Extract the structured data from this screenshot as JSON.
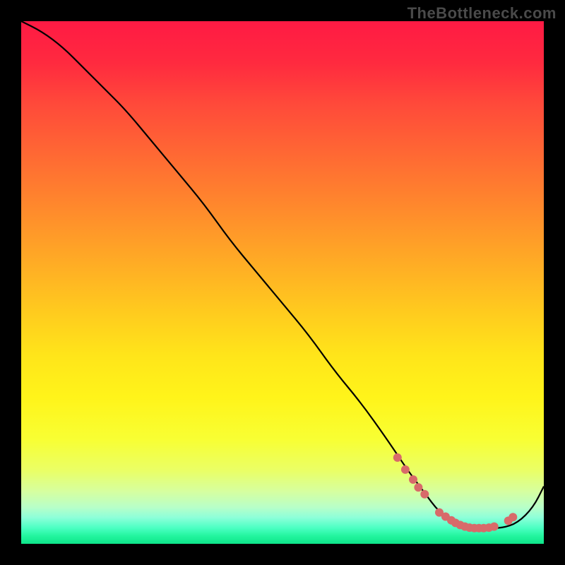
{
  "watermark": "TheBottleneck.com",
  "chart_data": {
    "type": "line",
    "title": "",
    "xlabel": "",
    "ylabel": "",
    "xlim": [
      0,
      100
    ],
    "ylim": [
      0,
      100
    ],
    "grid": false,
    "legend": false,
    "series": [
      {
        "name": "bottleneck-curve",
        "x": [
          0,
          4,
          8,
          12,
          16,
          20,
          25,
          30,
          35,
          40,
          45,
          50,
          55,
          60,
          65,
          70,
          74,
          77,
          80,
          83,
          86,
          89,
          92,
          95,
          98,
          100
        ],
        "y": [
          100,
          98,
          95,
          91,
          87,
          83,
          77,
          71,
          65,
          58,
          52,
          46,
          40,
          33,
          27,
          20,
          14,
          10,
          6,
          4,
          3,
          3,
          3,
          4,
          7,
          11
        ]
      }
    ],
    "markers": {
      "name": "highlighted-points",
      "color": "#d86a6a",
      "x": [
        72,
        73.5,
        75,
        76,
        77.2,
        80,
        81.2,
        82.3,
        83.1,
        84,
        84.9,
        85.8,
        86.7,
        87.6,
        88.5,
        89.5,
        90.5,
        93.2,
        94.1
      ],
      "y": [
        16.5,
        14.2,
        12.3,
        10.8,
        9.5,
        6.0,
        5.2,
        4.5,
        4.0,
        3.6,
        3.3,
        3.1,
        3.0,
        3.0,
        3.0,
        3.1,
        3.3,
        4.4,
        5.1
      ]
    },
    "background_gradient": {
      "top": "#ff1a44",
      "mid": "#ffe51a",
      "bottom": "#0ee58a"
    }
  }
}
